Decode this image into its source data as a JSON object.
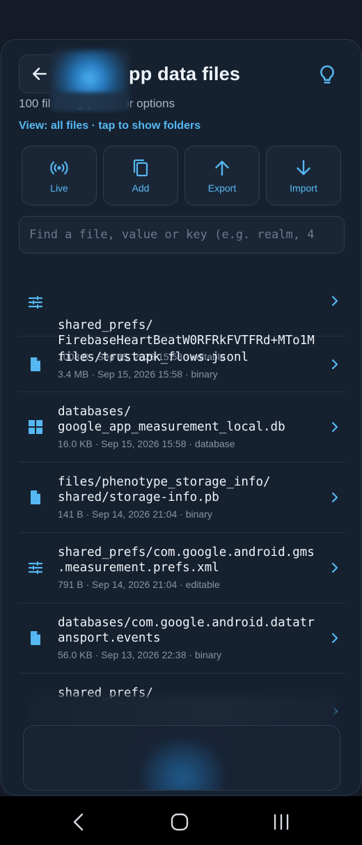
{
  "header": {
    "title": "pp data files",
    "subtitle": "100 fil                    · long-press for options",
    "view_toggle": "View: all files · tap to show folders"
  },
  "actions": [
    {
      "label": "Live",
      "icon": "broadcast-icon"
    },
    {
      "label": "Add",
      "icon": "copy-icon"
    },
    {
      "label": "Export",
      "icon": "arrow-up-icon"
    },
    {
      "label": "Import",
      "icon": "arrow-down-icon"
    }
  ],
  "search": {
    "placeholder": "Find a file, value or key (e.g. realm, 4",
    "value": ""
  },
  "files": [
    {
      "name": "shared_prefs/\nFirebaseHeartBeatW0RFRkFVTFRd+MTo1M",
      "size": "1008 B",
      "date": "Sep 15, 2026 15:58",
      "kind": "editable",
      "icon": "tune-icon"
    },
    {
      "name": "files/trustapk_flows.jsonl",
      "size": "3.4 MB",
      "date": "Sep 15, 2026 15:58",
      "kind": "binary",
      "icon": "file-icon"
    },
    {
      "name": "databases/\ngoogle_app_measurement_local.db",
      "size": "16.0 KB",
      "date": "Sep 15, 2026 15:58",
      "kind": "database",
      "icon": "grid-icon"
    },
    {
      "name": "files/phenotype_storage_info/\nshared/storage-info.pb",
      "size": "141 B",
      "date": "Sep 14, 2026 21:04",
      "kind": "binary",
      "icon": "file-icon"
    },
    {
      "name": "shared_prefs/com.google.android.gms\n.measurement.prefs.xml",
      "size": "791 B",
      "date": "Sep 14, 2026 21:04",
      "kind": "editable",
      "icon": "tune-icon"
    },
    {
      "name": "databases/com.google.android.datatr\nansport.events",
      "size": "56.0 KB",
      "date": "Sep 13, 2026 22:38",
      "kind": "binary",
      "icon": "file-icon"
    },
    {
      "name": "shared_prefs/",
      "size": "",
      "date": "",
      "kind": "",
      "icon": "tune-icon"
    }
  ],
  "colors": {
    "accent": "#56b8f2",
    "background": "#162130",
    "border": "#2d3d52"
  }
}
